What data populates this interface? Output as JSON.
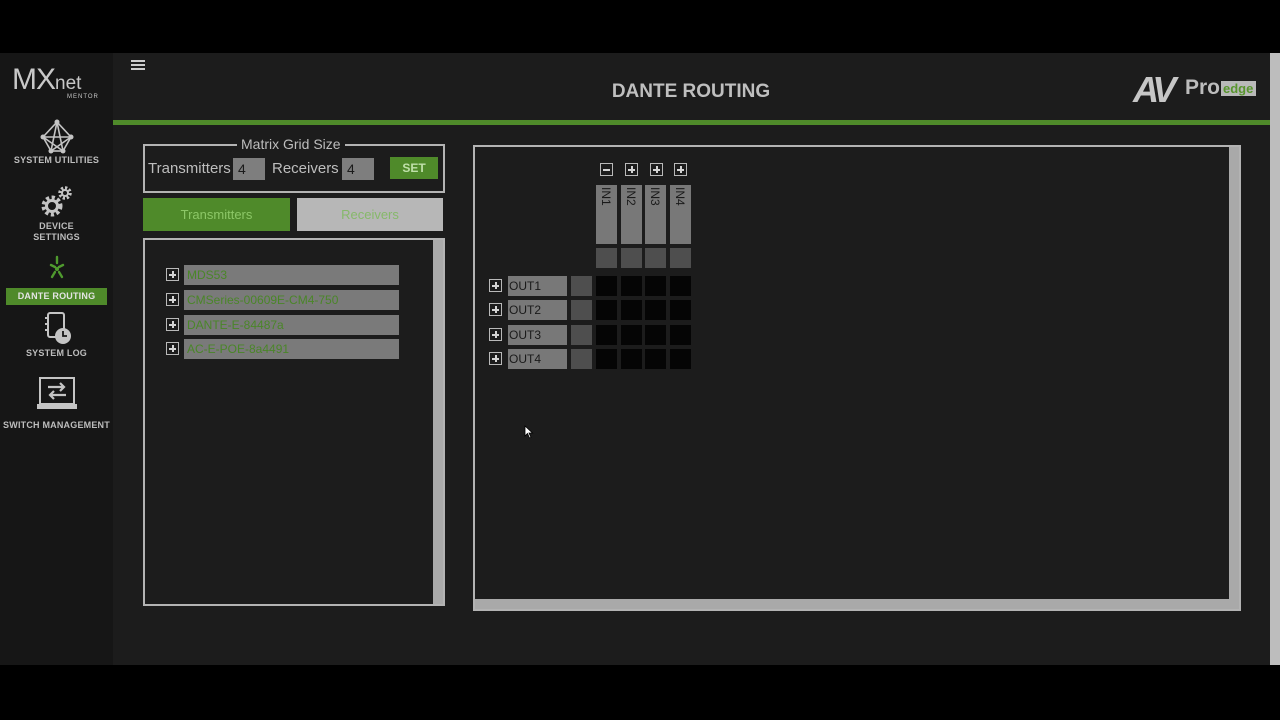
{
  "sidebar": {
    "logo": {
      "main": "MX",
      "suffix": "net",
      "sub": "MENTOR"
    },
    "items": [
      {
        "label": "SYSTEM UTILITIES",
        "icon": "network-icon"
      },
      {
        "label": "DEVICE\nSETTINGS",
        "icon": "gears-icon"
      },
      {
        "label": "DANTE ROUTING",
        "icon": "dante-icon",
        "active": true
      },
      {
        "label": "SYSTEM LOG",
        "icon": "log-clock-icon"
      },
      {
        "label": "SWITCH MANAGEMENT",
        "icon": "switch-icon"
      }
    ]
  },
  "header": {
    "title": "DANTE ROUTING",
    "brand": {
      "av": "AV",
      "pro": "Pro",
      "edge": "edge"
    }
  },
  "colors": {
    "accent": "#4f8a2a",
    "panel_border": "#b3b3b3",
    "background": "#1c1c1c"
  },
  "grid_size": {
    "title": "Matrix Grid Size",
    "transmitters_label": "Transmitters",
    "transmitters_value": "4",
    "receivers_label": "Receivers",
    "receivers_value": "4",
    "set_label": "SET"
  },
  "tabs": {
    "transmitters": "Transmitters",
    "receivers": "Receivers"
  },
  "devices": [
    "MDS53",
    "CMSeries-00609E-CM4-750",
    "DANTE-E-84487a",
    "AC-E-POE-8a4491"
  ],
  "matrix": {
    "inputs": [
      "IN1",
      "IN2",
      "IN3",
      "IN4"
    ],
    "outputs": [
      "OUT1",
      "OUT2",
      "OUT3",
      "OUT4"
    ]
  }
}
